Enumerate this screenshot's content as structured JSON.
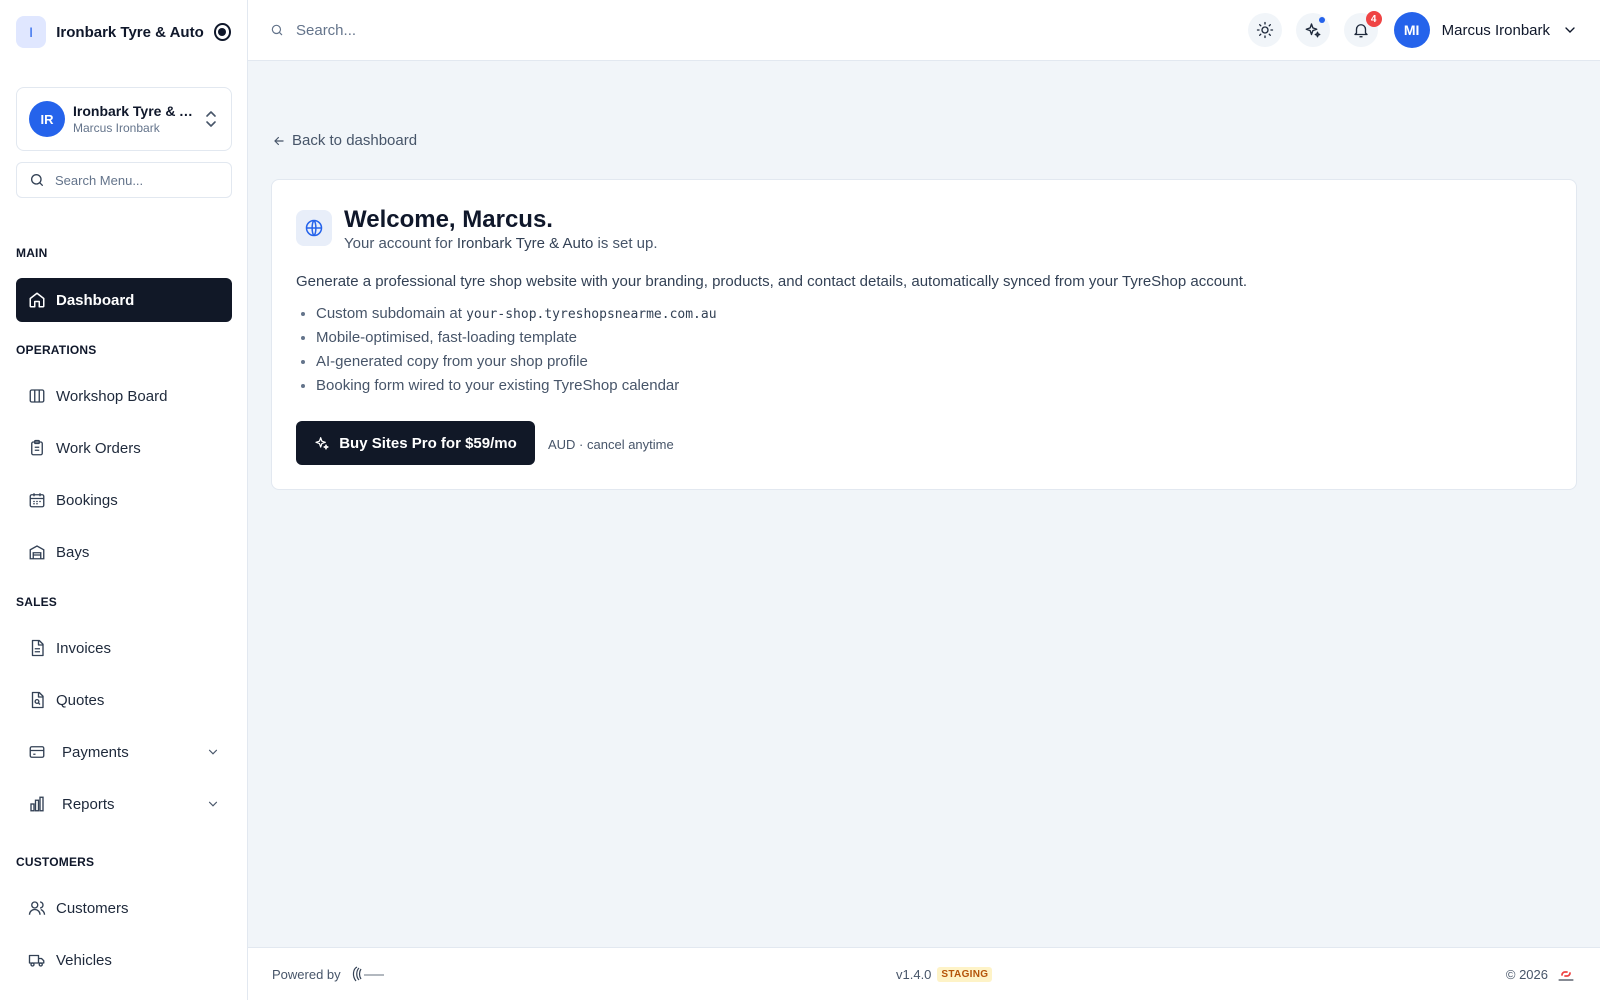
{
  "brand": {
    "initial": "I",
    "name": "Ironbark Tyre & Auto"
  },
  "account": {
    "initials": "IR",
    "name": "Ironbark Tyre & Auto",
    "user": "Marcus Ironbark"
  },
  "menu_search": {
    "placeholder": "Search Menu..."
  },
  "sidebar": {
    "sections": {
      "main": "MAIN",
      "operations": "OPERATIONS",
      "sales": "SALES",
      "customers": "CUSTOMERS"
    },
    "items": {
      "dashboard": "Dashboard",
      "workshop_board": "Workshop Board",
      "work_orders": "Work Orders",
      "bookings": "Bookings",
      "bays": "Bays",
      "invoices": "Invoices",
      "quotes": "Quotes",
      "payments": "Payments",
      "reports": "Reports",
      "customers": "Customers",
      "vehicles": "Vehicles"
    },
    "active": "dashboard"
  },
  "header": {
    "search_placeholder": "Search...",
    "notification_count": "4",
    "user_initials": "MI",
    "user_name": "Marcus Ironbark"
  },
  "main": {
    "back_link": "Back to dashboard",
    "welcome_title": "Welcome, Marcus.",
    "welcome_sub_prefix": "Your account for ",
    "welcome_sub_shop": "Ironbark Tyre & Auto",
    "welcome_sub_suffix": " is set up.",
    "description": "Generate a professional tyre shop website with your branding, products, and contact details, automatically synced from your TyreShop account.",
    "features": {
      "subdomain_prefix": "Custom subdomain at ",
      "subdomain": "your-shop.tyreshopsnearme.com.au",
      "mobile": "Mobile-optimised, fast-loading template",
      "ai_copy": "AI-generated copy from your shop profile",
      "booking": "Booking form wired to your existing TyreShop calendar"
    },
    "buy_button": "Buy Sites Pro for $59/mo",
    "buy_note": "AUD · cancel anytime"
  },
  "footer": {
    "powered_by": "Powered by",
    "version": "v1.4.0",
    "env_badge": "STAGING",
    "copyright": "© 2026"
  },
  "colors": {
    "accent": "#2563eb",
    "dark": "#111827",
    "badge_bg": "#fef3c7",
    "badge_text": "#b45309",
    "notify": "#ef4444"
  }
}
